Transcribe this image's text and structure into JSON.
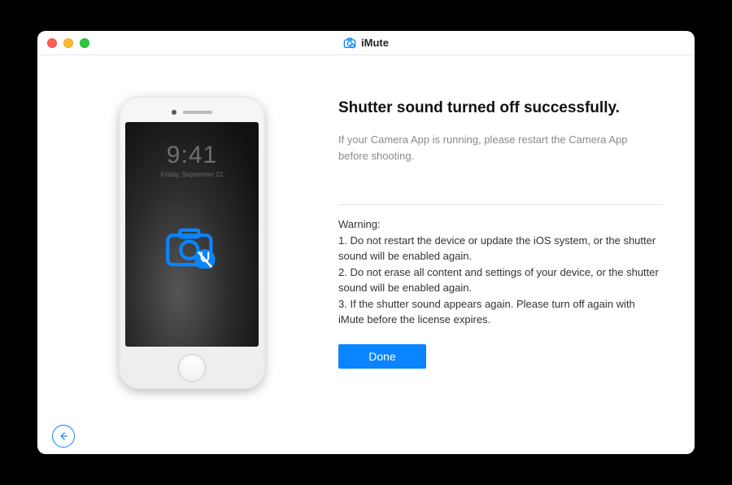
{
  "app": {
    "title": "iMute"
  },
  "phone": {
    "time": "9:41",
    "date": "Friday, September 22"
  },
  "main": {
    "headline": "Shutter sound turned off successfully.",
    "subtext": "If your Camera App is running, please restart the Camera App before shooting."
  },
  "warning": {
    "label": "Warning:",
    "item1": "1. Do not restart the device or update the iOS system, or the shutter sound will be enabled again.",
    "item2": "2. Do not erase all content and settings of your device, or the shutter sound will be enabled again.",
    "item3": "3. If the shutter sound appears again. Please turn off again with iMute before the license expires."
  },
  "buttons": {
    "done": "Done"
  }
}
